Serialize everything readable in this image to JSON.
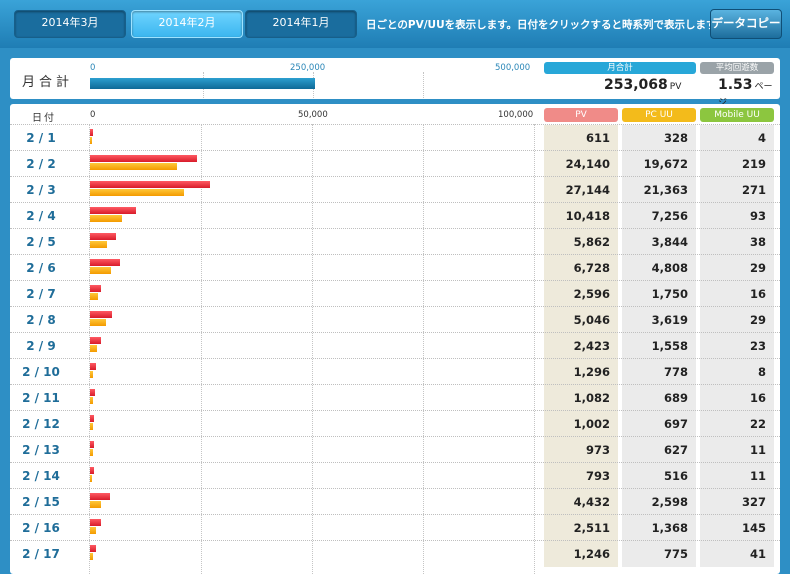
{
  "tabs": [
    {
      "label": "2014年3月",
      "active": false
    },
    {
      "label": "2014年2月",
      "active": true
    },
    {
      "label": "2014年1月",
      "active": false
    }
  ],
  "note": "日ごとのPV/UUを表示します。日付をクリックすると時系列で表示します",
  "copy_button": "データコピー",
  "summary": {
    "label": "月合計",
    "axis": [
      "0",
      "250,000",
      "500,000"
    ],
    "axis_max": 500000,
    "total_label": "月合計",
    "total_value": 253068,
    "total_display": "253,068",
    "total_unit": "PV",
    "avg_label": "平均回遊数",
    "avg_value": "1.53",
    "avg_unit": "ページ"
  },
  "table": {
    "date_header": "日付",
    "axis": [
      "0",
      "50,000",
      "100,000"
    ],
    "axis_max": 100000,
    "col_pv": "PV",
    "col_pc": "PC UU",
    "col_mobile": "Mobile UU",
    "rows": [
      {
        "date": "2 / 1",
        "pv": "611",
        "pc": "328",
        "mb": "4"
      },
      {
        "date": "2 / 2",
        "pv": "24,140",
        "pc": "19,672",
        "mb": "219"
      },
      {
        "date": "2 / 3",
        "pv": "27,144",
        "pc": "21,363",
        "mb": "271"
      },
      {
        "date": "2 / 4",
        "pv": "10,418",
        "pc": "7,256",
        "mb": "93"
      },
      {
        "date": "2 / 5",
        "pv": "5,862",
        "pc": "3,844",
        "mb": "38"
      },
      {
        "date": "2 / 6",
        "pv": "6,728",
        "pc": "4,808",
        "mb": "29"
      },
      {
        "date": "2 / 7",
        "pv": "2,596",
        "pc": "1,750",
        "mb": "16"
      },
      {
        "date": "2 / 8",
        "pv": "5,046",
        "pc": "3,619",
        "mb": "29"
      },
      {
        "date": "2 / 9",
        "pv": "2,423",
        "pc": "1,558",
        "mb": "23"
      },
      {
        "date": "2 / 10",
        "pv": "1,296",
        "pc": "778",
        "mb": "8"
      },
      {
        "date": "2 / 11",
        "pv": "1,082",
        "pc": "689",
        "mb": "16"
      },
      {
        "date": "2 / 12",
        "pv": "1,002",
        "pc": "697",
        "mb": "22"
      },
      {
        "date": "2 / 13",
        "pv": "973",
        "pc": "627",
        "mb": "11"
      },
      {
        "date": "2 / 14",
        "pv": "793",
        "pc": "516",
        "mb": "11"
      },
      {
        "date": "2 / 15",
        "pv": "4,432",
        "pc": "2,598",
        "mb": "327"
      },
      {
        "date": "2 / 16",
        "pv": "2,511",
        "pc": "1,368",
        "mb": "145"
      },
      {
        "date": "2 / 17",
        "pv": "1,246",
        "pc": "775",
        "mb": "41"
      }
    ]
  },
  "colors": {
    "pv": "#e8303b",
    "uu": "#f5a80f",
    "pv_header": "#f08b88",
    "pc_header": "#f3bb1b",
    "mobile_header": "#8cc63f",
    "total_header": "#27a7d8",
    "avg_header": "#9aa3a8"
  }
}
